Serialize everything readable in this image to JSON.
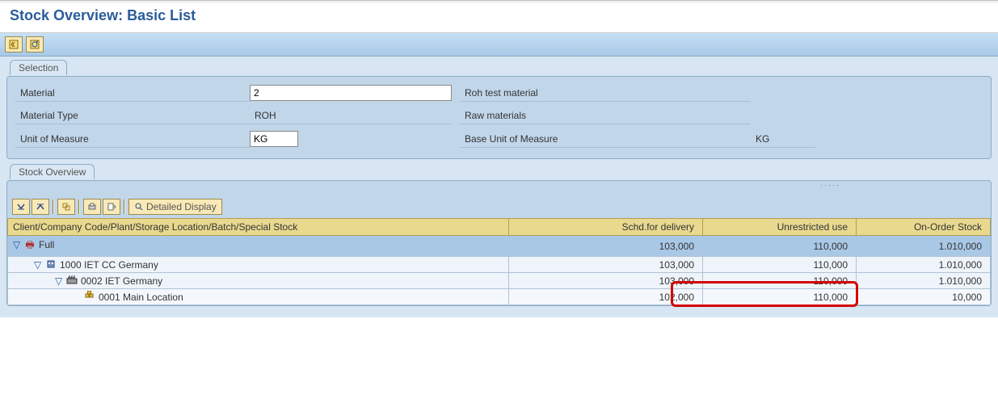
{
  "title": "Stock Overview: Basic List",
  "selection": {
    "tab_label": "Selection",
    "material_label": "Material",
    "material_value": "2",
    "material_desc": "Roh test material",
    "material_type_label": "Material Type",
    "material_type_value": "ROH",
    "material_type_desc": "Raw materials",
    "uom_label": "Unit of Measure",
    "uom_value": "KG",
    "base_uom_label": "Base Unit of Measure",
    "base_uom_value": "KG"
  },
  "stock_overview": {
    "tab_label": "Stock Overview",
    "detailed_display_label": "Detailed Display",
    "columns": {
      "hierarchy": "Client/Company Code/Plant/Storage Location/Batch/Special Stock",
      "schd": "Schd.for delivery",
      "unr": "Unrestricted use",
      "onorder": "On-Order Stock"
    },
    "rows": [
      {
        "indent": 0,
        "icon": "print",
        "label": "Full",
        "schd": "103,000",
        "unr": "110,000",
        "onorder": "1.010,000",
        "selected": true
      },
      {
        "indent": 1,
        "icon": "bldg",
        "label": "1000 IET CC Germany",
        "schd": "103,000",
        "unr": "110,000",
        "onorder": "1.010,000"
      },
      {
        "indent": 2,
        "icon": "plant",
        "label": "0002 IET Germany",
        "schd": "103,000",
        "unr": "110,000",
        "onorder": "1.010,000"
      },
      {
        "indent": 3,
        "icon": "loc",
        "label": "0001 Main Location",
        "schd": "102,000",
        "unr": "110,000",
        "onorder": "10,000",
        "leaf": true,
        "alt": true
      }
    ]
  }
}
